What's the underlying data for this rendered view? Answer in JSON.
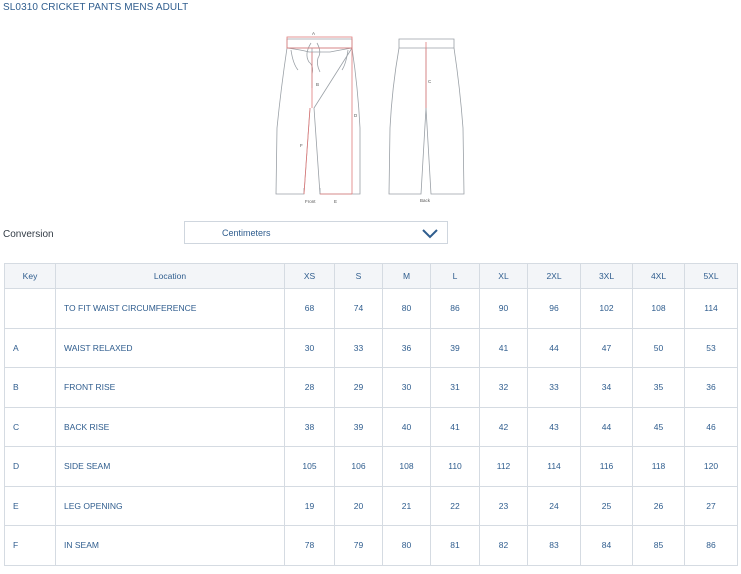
{
  "title": "SL0310 CRICKET PANTS MENS ADULT",
  "diagram": {
    "labels": {
      "a": "A",
      "b": "B",
      "c": "C",
      "d": "D",
      "e": "E",
      "f": "F"
    },
    "front": "Front",
    "back": "Back"
  },
  "conversion": {
    "label": "Conversion",
    "selected": "Centimeters",
    "chevron_icon": "chevron-down-icon"
  },
  "table": {
    "headers": [
      "Key",
      "Location",
      "XS",
      "S",
      "M",
      "L",
      "XL",
      "2XL",
      "3XL",
      "4XL",
      "5XL"
    ],
    "rows": [
      {
        "key": "",
        "location": "TO FIT WAIST CIRCUMFERENCE",
        "values": [
          "68",
          "74",
          "80",
          "86",
          "90",
          "96",
          "102",
          "108",
          "114"
        ]
      },
      {
        "key": "A",
        "location": "WAIST RELAXED",
        "values": [
          "30",
          "33",
          "36",
          "39",
          "41",
          "44",
          "47",
          "50",
          "53"
        ]
      },
      {
        "key": "B",
        "location": "FRONT RISE",
        "values": [
          "28",
          "29",
          "30",
          "31",
          "32",
          "33",
          "34",
          "35",
          "36"
        ]
      },
      {
        "key": "C",
        "location": "BACK RISE",
        "values": [
          "38",
          "39",
          "40",
          "41",
          "42",
          "43",
          "44",
          "45",
          "46"
        ]
      },
      {
        "key": "D",
        "location": "SIDE SEAM",
        "values": [
          "105",
          "106",
          "108",
          "110",
          "112",
          "114",
          "116",
          "118",
          "120"
        ]
      },
      {
        "key": "E",
        "location": "LEG OPENING",
        "values": [
          "19",
          "20",
          "21",
          "22",
          "23",
          "24",
          "25",
          "26",
          "27"
        ]
      },
      {
        "key": "F",
        "location": "IN SEAM",
        "values": [
          "78",
          "79",
          "80",
          "81",
          "82",
          "83",
          "84",
          "85",
          "86"
        ]
      }
    ]
  }
}
